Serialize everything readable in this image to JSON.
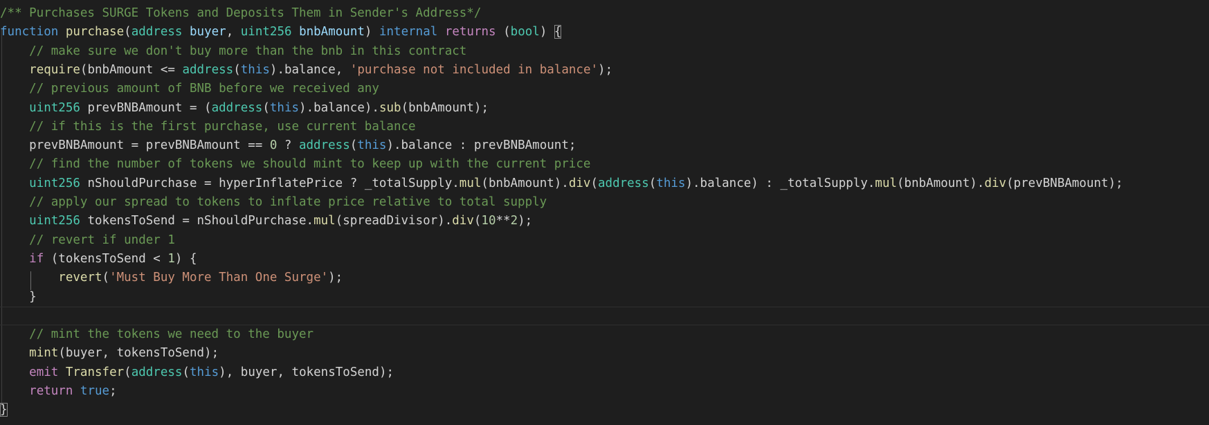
{
  "editor": {
    "theme": {
      "background": "#1e1e1e",
      "comment": "#6a9955",
      "keyword": "#c586c0",
      "storage": "#569cd6",
      "type": "#4ec9b0",
      "function": "#dcdcaa",
      "variable": "#9cdcfe",
      "string": "#ce9178",
      "number": "#b5cea8",
      "plain": "#d4d4d4"
    },
    "current_line": 16,
    "lines": [
      [
        [
          "comment",
          "/** Purchases SURGE Tokens and Deposits Them in Sender's Address*/"
        ]
      ],
      [
        [
          "storage",
          "function"
        ],
        [
          "plain",
          " "
        ],
        [
          "func",
          "purchase"
        ],
        [
          "plain",
          "("
        ],
        [
          "type",
          "address"
        ],
        [
          "plain",
          " "
        ],
        [
          "var",
          "buyer"
        ],
        [
          "plain",
          ", "
        ],
        [
          "type",
          "uint256"
        ],
        [
          "plain",
          " "
        ],
        [
          "var",
          "bnbAmount"
        ],
        [
          "plain",
          ") "
        ],
        [
          "storage",
          "internal"
        ],
        [
          "plain",
          " "
        ],
        [
          "keyword",
          "returns"
        ],
        [
          "plain",
          " ("
        ],
        [
          "type",
          "bool"
        ],
        [
          "plain",
          ") "
        ],
        [
          "brace",
          "{"
        ]
      ],
      [
        [
          "plain",
          "    "
        ],
        [
          "comment",
          "// make sure we don't buy more than the bnb in this contract"
        ]
      ],
      [
        [
          "plain",
          "    "
        ],
        [
          "func",
          "require"
        ],
        [
          "plain",
          "(bnbAmount <= "
        ],
        [
          "type",
          "address"
        ],
        [
          "plain",
          "("
        ],
        [
          "storage",
          "this"
        ],
        [
          "plain",
          ").balance, "
        ],
        [
          "string",
          "'purchase not included in balance'"
        ],
        [
          "plain",
          ");"
        ]
      ],
      [
        [
          "plain",
          "    "
        ],
        [
          "comment",
          "// previous amount of BNB before we received any"
        ]
      ],
      [
        [
          "plain",
          "    "
        ],
        [
          "type",
          "uint256"
        ],
        [
          "plain",
          " prevBNBAmount = ("
        ],
        [
          "type",
          "address"
        ],
        [
          "plain",
          "("
        ],
        [
          "storage",
          "this"
        ],
        [
          "plain",
          ").balance)."
        ],
        [
          "func",
          "sub"
        ],
        [
          "plain",
          "(bnbAmount);"
        ]
      ],
      [
        [
          "plain",
          "    "
        ],
        [
          "comment",
          "// if this is the first purchase, use current balance"
        ]
      ],
      [
        [
          "plain",
          "    prevBNBAmount = prevBNBAmount == "
        ],
        [
          "number",
          "0"
        ],
        [
          "plain",
          " ? "
        ],
        [
          "type",
          "address"
        ],
        [
          "plain",
          "("
        ],
        [
          "storage",
          "this"
        ],
        [
          "plain",
          ").balance : prevBNBAmount;"
        ]
      ],
      [
        [
          "plain",
          "    "
        ],
        [
          "comment",
          "// find the number of tokens we should mint to keep up with the current price"
        ]
      ],
      [
        [
          "plain",
          "    "
        ],
        [
          "type",
          "uint256"
        ],
        [
          "plain",
          " nShouldPurchase = hyperInflatePrice ? _totalSupply."
        ],
        [
          "func",
          "mul"
        ],
        [
          "plain",
          "(bnbAmount)."
        ],
        [
          "func",
          "div"
        ],
        [
          "plain",
          "("
        ],
        [
          "type",
          "address"
        ],
        [
          "plain",
          "("
        ],
        [
          "storage",
          "this"
        ],
        [
          "plain",
          ").balance) : _totalSupply."
        ],
        [
          "func",
          "mul"
        ],
        [
          "plain",
          "(bnbAmount)."
        ],
        [
          "func",
          "div"
        ],
        [
          "plain",
          "(prevBNBAmount);"
        ]
      ],
      [
        [
          "plain",
          "    "
        ],
        [
          "comment",
          "// apply our spread to tokens to inflate price relative to total supply"
        ]
      ],
      [
        [
          "plain",
          "    "
        ],
        [
          "type",
          "uint256"
        ],
        [
          "plain",
          " tokensToSend = nShouldPurchase."
        ],
        [
          "func",
          "mul"
        ],
        [
          "plain",
          "(spreadDivisor)."
        ],
        [
          "func",
          "div"
        ],
        [
          "plain",
          "("
        ],
        [
          "number",
          "10"
        ],
        [
          "plain",
          "**"
        ],
        [
          "number",
          "2"
        ],
        [
          "plain",
          ");"
        ]
      ],
      [
        [
          "plain",
          "    "
        ],
        [
          "comment",
          "// revert if under 1"
        ]
      ],
      [
        [
          "plain",
          "    "
        ],
        [
          "keyword",
          "if"
        ],
        [
          "plain",
          " (tokensToSend < "
        ],
        [
          "number",
          "1"
        ],
        [
          "plain",
          ") {"
        ]
      ],
      [
        [
          "plain",
          "        "
        ],
        [
          "func",
          "revert"
        ],
        [
          "plain",
          "("
        ],
        [
          "string",
          "'Must Buy More Than One Surge'"
        ],
        [
          "plain",
          ");"
        ]
      ],
      [
        [
          "plain",
          "    }"
        ]
      ],
      [
        [
          "plain",
          ""
        ]
      ],
      [
        [
          "plain",
          "    "
        ],
        [
          "comment",
          "// mint the tokens we need to the buyer"
        ]
      ],
      [
        [
          "plain",
          "    "
        ],
        [
          "func",
          "mint"
        ],
        [
          "plain",
          "(buyer, tokensToSend);"
        ]
      ],
      [
        [
          "plain",
          "    "
        ],
        [
          "keyword",
          "emit"
        ],
        [
          "plain",
          " "
        ],
        [
          "func",
          "Transfer"
        ],
        [
          "plain",
          "("
        ],
        [
          "type",
          "address"
        ],
        [
          "plain",
          "("
        ],
        [
          "storage",
          "this"
        ],
        [
          "plain",
          "), buyer, tokensToSend);"
        ]
      ],
      [
        [
          "plain",
          "    "
        ],
        [
          "keyword",
          "return"
        ],
        [
          "plain",
          " "
        ],
        [
          "storage",
          "true"
        ],
        [
          "plain",
          ";"
        ]
      ],
      [
        [
          "brace",
          "}"
        ]
      ]
    ]
  }
}
